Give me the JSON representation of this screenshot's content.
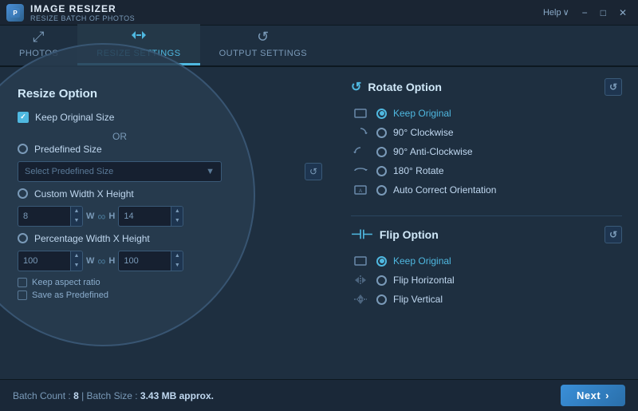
{
  "titlebar": {
    "app_name": "IMAGE RESIZER",
    "app_subtitle": "RESIZE BATCH OF PHOTOS",
    "help_label": "Help",
    "minimize_label": "−",
    "maximize_label": "□",
    "close_label": "✕"
  },
  "tabs": [
    {
      "id": "photos",
      "label": "PHOTOS",
      "icon": "⤢",
      "active": false
    },
    {
      "id": "resize",
      "label": "RESIZE SETTINGS",
      "icon": "⊣⊢",
      "active": true
    },
    {
      "id": "output",
      "label": "OUTPUT SETTINGS",
      "icon": "↺",
      "active": false
    }
  ],
  "resize_option": {
    "title": "Resize Option",
    "keep_original_size": {
      "label": "Keep Original Size",
      "checked": true
    },
    "or_label": "OR",
    "predefined_size": {
      "label": "Predefined Size",
      "checked": false,
      "placeholder": "Select Predefined Size"
    },
    "custom_wh": {
      "label": "Custom Width X Height",
      "checked": false,
      "width_val": "8",
      "height_val": "14",
      "w_label": "W",
      "h_label": "H"
    },
    "percentage_wh": {
      "label": "Percentage Width X Height",
      "checked": false,
      "width_val": "100",
      "height_val": "100",
      "w_label": "W",
      "h_label": "H"
    },
    "keep_aspect_ratio": {
      "label": "Keep aspect ratio",
      "checked": false
    },
    "save_as_predefined": {
      "label": "Save as Predefined",
      "checked": false
    }
  },
  "rotate_option": {
    "title": "Rotate Option",
    "options": [
      {
        "label": "Keep Original",
        "active": true
      },
      {
        "label": "90° Clockwise",
        "active": false
      },
      {
        "label": "90° Anti-Clockwise",
        "active": false
      },
      {
        "label": "180° Rotate",
        "active": false
      },
      {
        "label": "Auto Correct Orientation",
        "active": false
      }
    ]
  },
  "flip_option": {
    "title": "Flip Option",
    "options": [
      {
        "label": "Keep Original",
        "active": true
      },
      {
        "label": "Flip Horizontal",
        "active": false
      },
      {
        "label": "Flip Vertical",
        "active": false
      }
    ]
  },
  "status": {
    "batch_count_label": "Batch Count :",
    "batch_count": "8",
    "batch_size_label": "Batch Size :",
    "batch_size": "3.43 MB approx."
  },
  "next_button": {
    "label": "Next",
    "arrow": "›"
  }
}
